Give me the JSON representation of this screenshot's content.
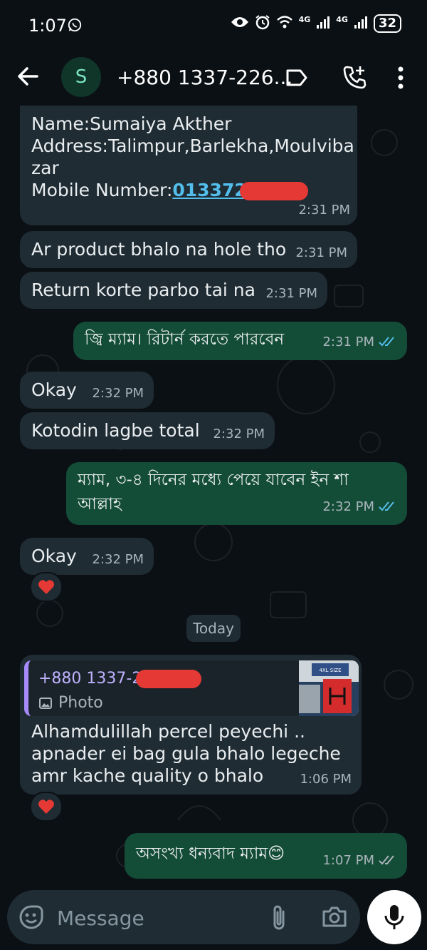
{
  "status_bar": {
    "time": "1:07",
    "battery": "32",
    "net1": "4G",
    "net2": "4G"
  },
  "header": {
    "avatar_letter": "S",
    "title": "+880 1337-226..."
  },
  "messages": {
    "m1": {
      "line1": "Name:Sumaiya Akther",
      "line2": "Address:Talimpur,Barlekha,Moulviba",
      "line3": "zar",
      "mobile_label": "Mobile Number:",
      "mobile_value": "013372",
      "time": "2:31 PM"
    },
    "m2": {
      "text": "Ar product bhalo na hole tho",
      "time": "2:31 PM"
    },
    "m3": {
      "text": "Return korte parbo tai na",
      "time": "2:31 PM"
    },
    "m4": {
      "text": "জ্বি ম্যাম। রিটার্ন করতে পারবেন",
      "time": "2:31 PM"
    },
    "m5": {
      "text": "Okay",
      "time": "2:32 PM"
    },
    "m6": {
      "text": "Kotodin lagbe total",
      "time": "2:32 PM"
    },
    "m7": {
      "line1": "ম্যাম, ৩-৪ দিনের মধ্যে পেয়ে যাবেন ইন শা",
      "line2": "আল্লাহ",
      "time": "2:32 PM"
    },
    "m8": {
      "text": "Okay",
      "time": "2:32 PM",
      "reaction": "❤️"
    },
    "day_chip": "Today",
    "m9": {
      "quote_name": "+880 1337-2",
      "quote_type": "Photo",
      "thumb_text": "4XL SIZE",
      "line1": "Alhamdulillah percel peyechi ..",
      "line2": "apnader ei bag gula bhalo legeche",
      "line3": "amr kache quality o bhalo",
      "time": "1:06 PM",
      "reaction": "❤️"
    },
    "m10": {
      "text": "অসংখ্য ধন্যবাদ ম্যাম😊",
      "time": "1:07 PM"
    }
  },
  "composer": {
    "placeholder": "Message"
  },
  "colors": {
    "incoming": "#1f2c34",
    "outgoing": "#144d37",
    "link": "#53bdeb",
    "read_tick": "#53bdeb"
  }
}
